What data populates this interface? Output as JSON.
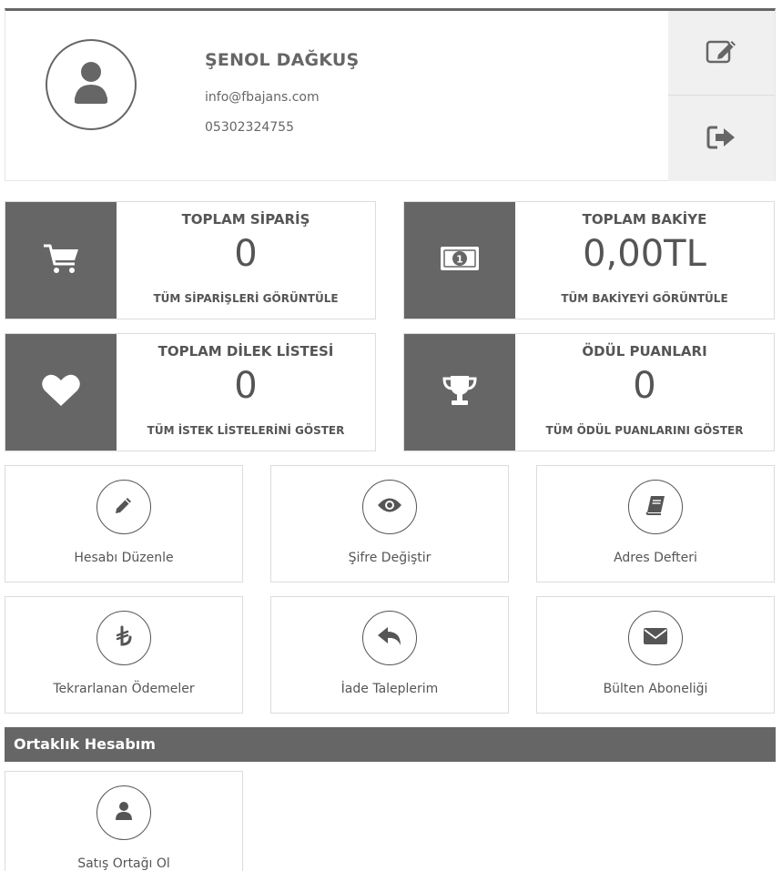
{
  "profile": {
    "name": "ŞENOL DAĞKUŞ",
    "email": "info@fbajans.com",
    "phone": "05302324755",
    "icons": {
      "avatar": "user-icon",
      "edit": "edit-icon",
      "logout": "sign-out-icon"
    }
  },
  "stats": [
    {
      "title": "TOPLAM SİPARİŞ",
      "value": "0",
      "link": "TÜM SİPARİŞLERİ GÖRÜNTÜLE",
      "icon": "shopping-cart-icon"
    },
    {
      "title": "TOPLAM BAKİYE",
      "value": "0,00TL",
      "link": "TÜM BAKİYEYİ GÖRÜNTÜLE",
      "icon": "money-bill-icon"
    },
    {
      "title": "TOPLAM DİLEK LİSTESİ",
      "value": "0",
      "link": "TÜM İSTEK LİSTELERİNİ GÖSTER",
      "icon": "heart-icon"
    },
    {
      "title": "ÖDÜL PUANLARI",
      "value": "0",
      "link": "TÜM ÖDÜL PUANLARINI GÖSTER",
      "icon": "trophy-icon"
    }
  ],
  "actions": [
    {
      "label": "Hesabı Düzenle",
      "icon": "pencil-icon"
    },
    {
      "label": "Şifre Değiştir",
      "icon": "eye-icon"
    },
    {
      "label": "Adres Defteri",
      "icon": "book-icon"
    },
    {
      "label": "Tekrarlanan Ödemeler",
      "icon": "lira-icon"
    },
    {
      "label": "İade Taleplerim",
      "icon": "reply-icon"
    },
    {
      "label": "Bülten Aboneliği",
      "icon": "envelope-icon"
    }
  ],
  "affiliate": {
    "section_title": "Ortaklık Hesabım",
    "items": [
      {
        "label": "Satış Ortağı Ol",
        "icon": "user-icon"
      }
    ]
  },
  "colors": {
    "accent": "#666666",
    "text": "#555555",
    "border": "#dcdcdc",
    "side_panel": "#f0f0f0"
  }
}
